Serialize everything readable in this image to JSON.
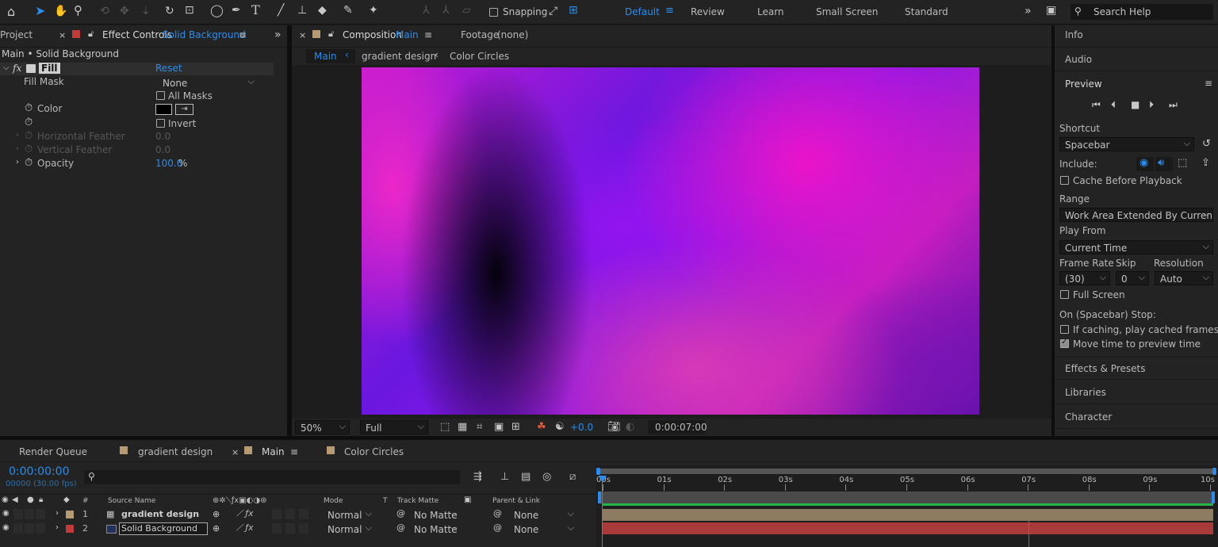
{
  "toolbar": {
    "snapping_label": "Snapping",
    "workspaces": [
      "Default",
      "Review",
      "Learn",
      "Small Screen",
      "Standard"
    ],
    "search_placeholder": "Search Help"
  },
  "left_panel": {
    "project_tab": "Project",
    "effect_controls_tab": "Effect Controls",
    "effect_controls_target": "Solid Background",
    "breadcrumb": "Main • Solid Background",
    "effect_name": "Fill",
    "reset_label": "Reset",
    "props": {
      "fill_mask_label": "Fill Mask",
      "fill_mask_value": "None",
      "all_masks_label": "All Masks",
      "color_label": "Color",
      "invert_label": "Invert",
      "horizontal_feather_label": "Horizontal Feather",
      "horizontal_feather_value": "0.0",
      "vertical_feather_label": "Vertical Feather",
      "vertical_feather_value": "0.0",
      "opacity_label": "Opacity",
      "opacity_value": "100.0",
      "opacity_unit": "%"
    }
  },
  "composition": {
    "tab_label": "Composition",
    "tab_target": "Main",
    "footage_label": "Footage",
    "footage_value": "(none)",
    "breadcrumbs": [
      "Main",
      "gradient design",
      "Color Circles"
    ],
    "zoom": "50%",
    "resolution": "Full",
    "exposure": "+0.0",
    "timecode": "0:00:07:00"
  },
  "right_panel": {
    "info": "Info",
    "audio": "Audio",
    "preview": "Preview",
    "shortcut_label": "Shortcut",
    "shortcut_value": "Spacebar",
    "include_label": "Include:",
    "cache_before_playback": "Cache Before Playback",
    "range_label": "Range",
    "range_value": "Work Area Extended By Current...",
    "play_from_label": "Play From",
    "play_from_value": "Current Time",
    "frame_rate_label": "Frame Rate",
    "skip_label": "Skip",
    "resolution_label": "Resolution",
    "frame_rate_value": "(30)",
    "skip_value": "0",
    "resolution_value": "Auto",
    "full_screen": "Full Screen",
    "on_stop_label": "On (Spacebar) Stop:",
    "if_caching": "If caching, play cached frames",
    "move_time": "Move time to preview time",
    "effects_presets": "Effects & Presets",
    "libraries": "Libraries",
    "character": "Character"
  },
  "timeline": {
    "tabs": [
      "Render Queue",
      "gradient design",
      "Main",
      "Color Circles"
    ],
    "current_time": "0:00:00:00",
    "frame_info": "00000 (30.00 fps)",
    "columns": {
      "source_name": "Source Name",
      "mode": "Mode",
      "t": "T",
      "track_matte": "Track Matte",
      "parent_link": "Parent & Link",
      "hash": "#"
    },
    "layers": [
      {
        "num": "1",
        "name": "gradient design",
        "mode": "Normal",
        "matte": "No Matte",
        "parent": "None",
        "label_color": "#b59a73"
      },
      {
        "num": "2",
        "name": "Solid Background",
        "mode": "Normal",
        "matte": "No Matte",
        "parent": "None",
        "label_color": "#c23b3b"
      }
    ],
    "ruler": [
      "00s",
      "01s",
      "02s",
      "03s",
      "04s",
      "05s",
      "06s",
      "07s",
      "08s",
      "09s",
      "10s"
    ]
  }
}
